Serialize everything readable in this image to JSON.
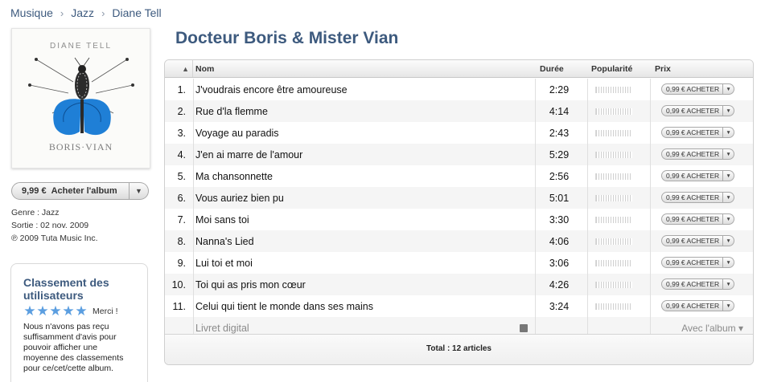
{
  "breadcrumb": [
    "Musique",
    "Jazz",
    "Diane Tell"
  ],
  "album": {
    "title": "Docteur Boris & Mister Vian",
    "artwork": {
      "artist_text": "DIANE TELL",
      "title_text": "BORIS·VIAN"
    },
    "buy": {
      "price": "9,99 €",
      "label": "Acheter l'album"
    },
    "genre": "Genre : Jazz",
    "release": "Sortie : 02 nov. 2009",
    "copyright": "℗ 2009 Tuta Music Inc."
  },
  "ratings": {
    "title": "Classement des utilisateurs",
    "stars": 5,
    "thanks": "Merci !",
    "note": "Nous n'avons pas reçu suffisamment d'avis pour pouvoir afficher une moyenne des classements pour ce/cet/cette album."
  },
  "table": {
    "headers": {
      "name": "Nom",
      "duration": "Durée",
      "popularity": "Popularité",
      "price": "Prix"
    },
    "tracks": [
      {
        "num": "1.",
        "name": "J'voudrais encore être amoureuse",
        "duration": "2:29",
        "price": "0,99 € ACHETER"
      },
      {
        "num": "2.",
        "name": "Rue d'la flemme",
        "duration": "4:14",
        "price": "0,99 € ACHETER"
      },
      {
        "num": "3.",
        "name": "Voyage au paradis",
        "duration": "2:43",
        "price": "0,99 € ACHETER"
      },
      {
        "num": "4.",
        "name": "J'en ai marre de l'amour",
        "duration": "5:29",
        "price": "0,99 € ACHETER"
      },
      {
        "num": "5.",
        "name": "Ma chansonnette",
        "duration": "2:56",
        "price": "0,99 € ACHETER"
      },
      {
        "num": "6.",
        "name": "Vous auriez bien pu",
        "duration": "5:01",
        "price": "0,99 € ACHETER"
      },
      {
        "num": "7.",
        "name": "Moi sans toi",
        "duration": "3:30",
        "price": "0,99 € ACHETER"
      },
      {
        "num": "8.",
        "name": "Nanna's Lied",
        "duration": "4:06",
        "price": "0,99 € ACHETER"
      },
      {
        "num": "9.",
        "name": "Lui toi et moi",
        "duration": "3:06",
        "price": "0,99 € ACHETER"
      },
      {
        "num": "10.",
        "name": "Toi qui as pris mon cœur",
        "duration": "4:26",
        "price": "0,99 € ACHETER"
      },
      {
        "num": "11.",
        "name": "Celui qui tient le monde dans ses mains",
        "duration": "3:24",
        "price": "0,99 € ACHETER"
      }
    ],
    "booklet": {
      "name": "Livret digital",
      "with_album": "Avec l'album ▾"
    },
    "total": "Total : 12 articles"
  },
  "colors": {
    "link": "#3d5a7e",
    "star": "#5b9ee0",
    "butterfly": "#1f7fd6"
  }
}
